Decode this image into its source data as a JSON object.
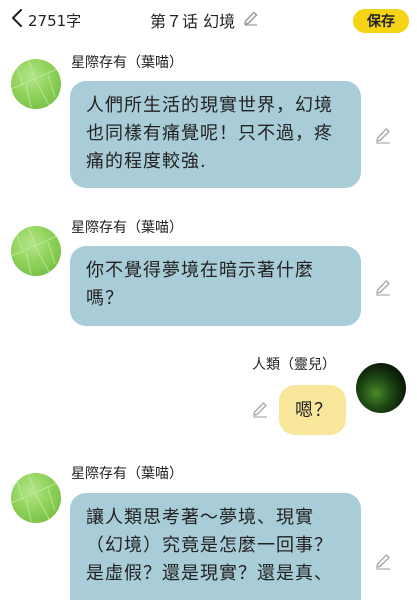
{
  "header": {
    "back_icon": "chevron-left-icon",
    "word_count": "2751字",
    "title": "第７话 幻境",
    "title_edit_icon": "pencil-icon",
    "save_label": "保存",
    "save_color": "#f5d315"
  },
  "messages": [
    {
      "sender": "星際存有（葉喵）",
      "text_lines": [
        "人們所生活的現實世界，幻境",
        "也同樣有痛覺呢！只不過，疼",
        "痛的程度較強."
      ],
      "side": "left",
      "bubble_color": "#a9cdd8"
    },
    {
      "sender": "星際存有（葉喵）",
      "text_lines": [
        "你不覺得夢境在暗示著什麼",
        "嗎？"
      ],
      "side": "left",
      "bubble_color": "#a9cdd8"
    },
    {
      "sender": "人類（靈兒）",
      "text_lines": [
        "嗯？"
      ],
      "side": "right",
      "bubble_color": "#f8e79a"
    },
    {
      "sender": "星際存有（葉喵）",
      "text_lines": [
        "讓人類思考著～夢境、現實",
        "（幻境）究竟是怎麼一回事？",
        "是虛假？還是現實？還是真、"
      ],
      "side": "left",
      "bubble_color": "#a9cdd8"
    }
  ]
}
